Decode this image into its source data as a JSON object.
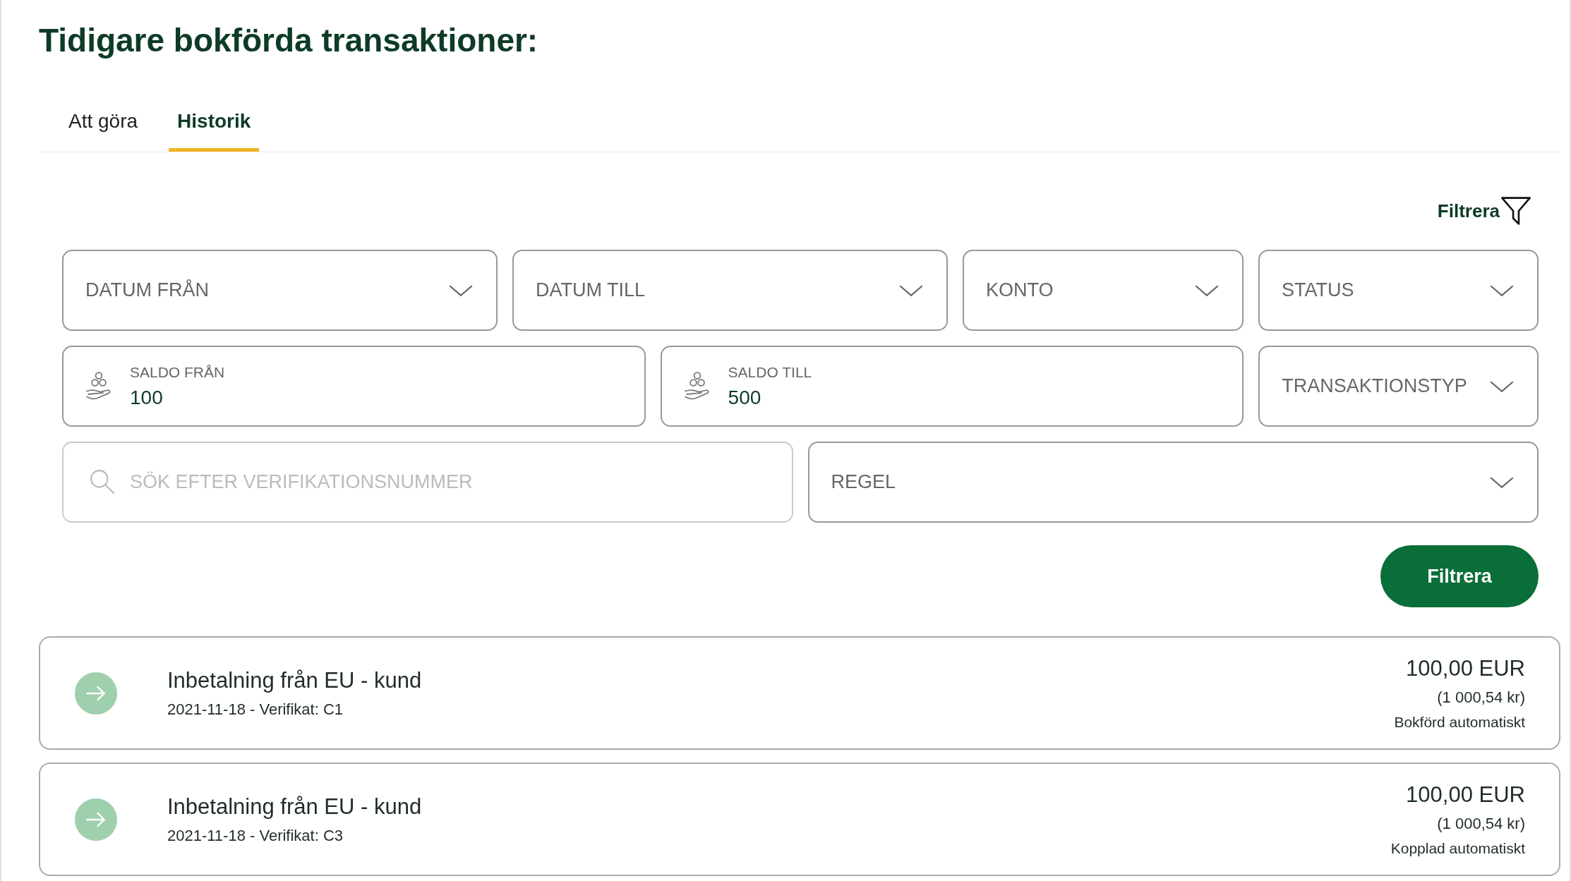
{
  "title": "Tidigare bokförda transaktioner:",
  "tabs": [
    {
      "label": "Att göra",
      "selected": false
    },
    {
      "label": "Historik",
      "selected": true
    }
  ],
  "filter_toggle": {
    "label": "Filtrera"
  },
  "filter_rows": [
    [
      {
        "kind": "dropdown",
        "label": "DATUM FRÅN"
      },
      {
        "kind": "dropdown",
        "label": "DATUM TILL"
      },
      {
        "kind": "dropdown",
        "label": "KONTO"
      },
      {
        "kind": "dropdown",
        "label": "STATUS"
      }
    ],
    [
      {
        "kind": "amount",
        "label": "SALDO FRÅN",
        "value": "100"
      },
      {
        "kind": "amount",
        "label": "SALDO TILL",
        "value": "500"
      },
      {
        "kind": "dropdown",
        "label": "TRANSAKTIONSTYP"
      }
    ],
    [
      {
        "kind": "search",
        "placeholder": "SÖK EFTER VERIFIKATIONSNUMMER"
      },
      {
        "kind": "dropdown",
        "label": "REGEL"
      }
    ]
  ],
  "filter_button": {
    "label": "Filtrera"
  },
  "transactions": [
    {
      "title": "Inbetalning från EU - kund",
      "meta": "2021-11-18 - Verifikat: C1",
      "amount": "100,00 EUR",
      "amount_sek": "(1 000,54 kr)",
      "status": "Bokförd automatiskt"
    },
    {
      "title": "Inbetalning från EU - kund",
      "meta": "2021-11-18 - Verifikat: C3",
      "amount": "100,00 EUR",
      "amount_sek": "(1 000,54 kr)",
      "status": "Kopplad automatiskt"
    }
  ]
}
